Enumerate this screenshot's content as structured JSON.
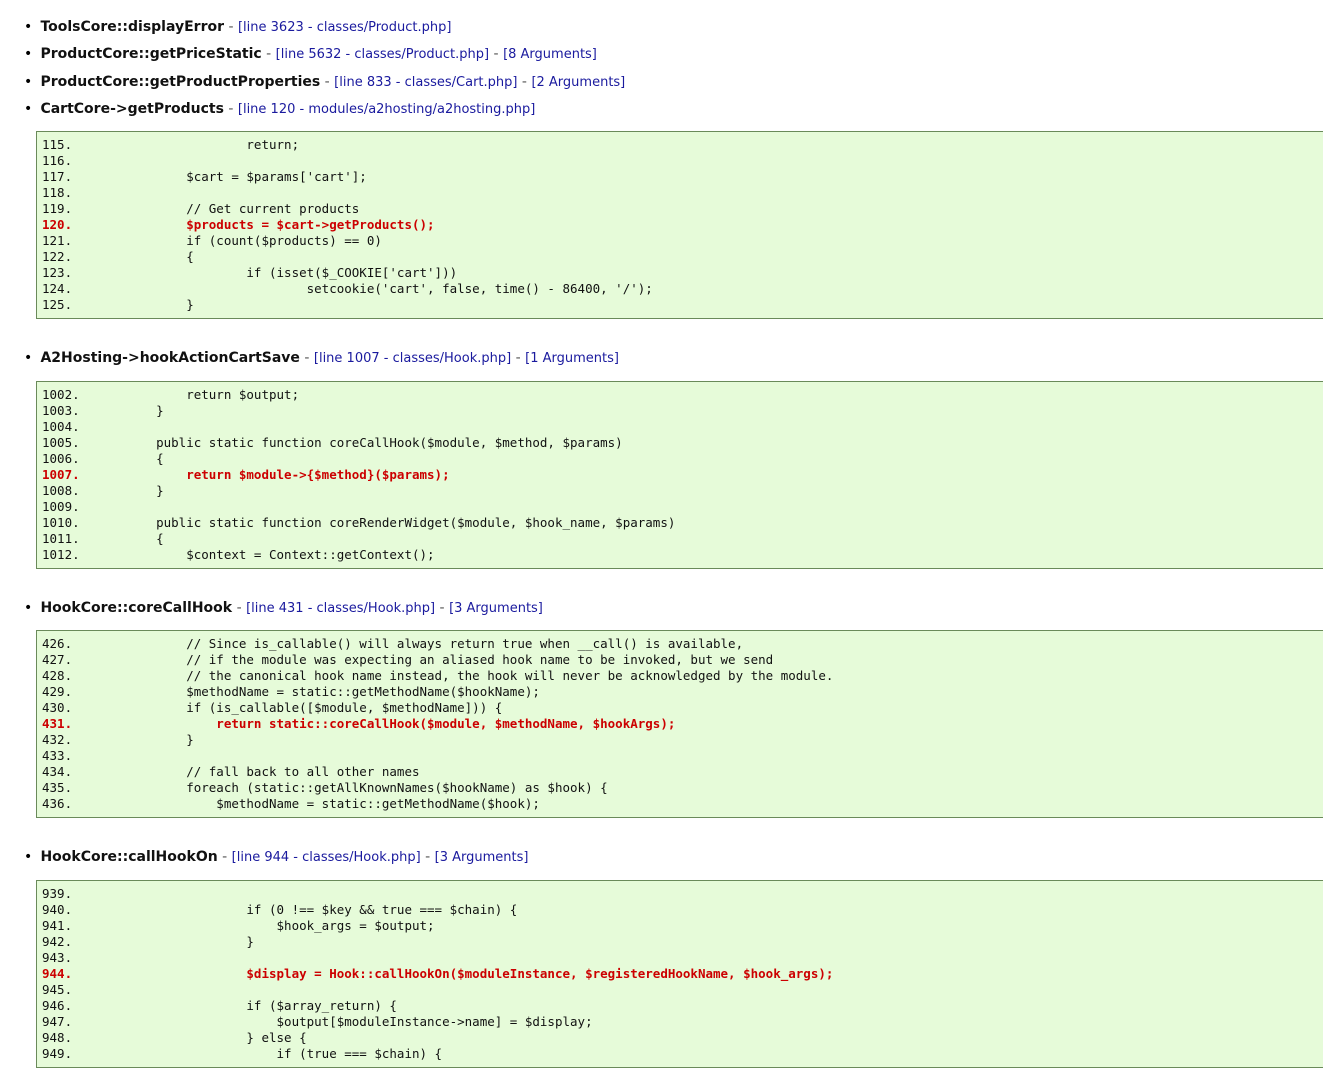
{
  "trace_items": [
    {
      "func": "ToolsCore::displayError",
      "location": "[line 3623 - classes/Product.php]",
      "args": ""
    },
    {
      "func": "ProductCore::getPriceStatic",
      "location": "[line 5632 - classes/Product.php]",
      "args": "[8 Arguments]"
    },
    {
      "func": "ProductCore::getProductProperties",
      "location": "[line 833 - classes/Cart.php]",
      "args": "[2 Arguments]"
    },
    {
      "func": "CartCore->getProducts",
      "location": "[line 120 - modules/a2hosting/a2hosting.php]",
      "args": ""
    },
    {
      "func": "A2Hosting->hookActionCartSave",
      "location": "[line 1007 - classes/Hook.php]",
      "args": "[1 Arguments]"
    },
    {
      "func": "HookCore::coreCallHook",
      "location": "[line 431 - classes/Hook.php]",
      "args": "[3 Arguments]"
    },
    {
      "func": "HookCore::callHookOn",
      "location": "[line 944 - classes/Hook.php]",
      "args": "[3 Arguments]"
    }
  ],
  "separator": "-",
  "code_blocks": [
    {
      "lines": [
        {
          "num": "115.",
          "code": "                return;",
          "hl": false
        },
        {
          "num": "116.",
          "code": "",
          "hl": false
        },
        {
          "num": "117.",
          "code": "        $cart = $params['cart'];",
          "hl": false
        },
        {
          "num": "118.",
          "code": "",
          "hl": false
        },
        {
          "num": "119.",
          "code": "        // Get current products",
          "hl": false
        },
        {
          "num": "120.",
          "code": "        $products = $cart->getProducts();",
          "hl": true
        },
        {
          "num": "121.",
          "code": "        if (count($products) == 0)",
          "hl": false
        },
        {
          "num": "122.",
          "code": "        {",
          "hl": false
        },
        {
          "num": "123.",
          "code": "                if (isset($_COOKIE['cart']))",
          "hl": false
        },
        {
          "num": "124.",
          "code": "                        setcookie('cart', false, time() - 86400, '/');",
          "hl": false
        },
        {
          "num": "125.",
          "code": "        }",
          "hl": false
        }
      ]
    },
    {
      "lines": [
        {
          "num": "1002.",
          "code": "        return $output;",
          "hl": false
        },
        {
          "num": "1003.",
          "code": "    }",
          "hl": false
        },
        {
          "num": "1004.",
          "code": "",
          "hl": false
        },
        {
          "num": "1005.",
          "code": "    public static function coreCallHook($module, $method, $params)",
          "hl": false
        },
        {
          "num": "1006.",
          "code": "    {",
          "hl": false
        },
        {
          "num": "1007.",
          "code": "        return $module->{$method}($params);",
          "hl": true
        },
        {
          "num": "1008.",
          "code": "    }",
          "hl": false
        },
        {
          "num": "1009.",
          "code": "",
          "hl": false
        },
        {
          "num": "1010.",
          "code": "    public static function coreRenderWidget($module, $hook_name, $params)",
          "hl": false
        },
        {
          "num": "1011.",
          "code": "    {",
          "hl": false
        },
        {
          "num": "1012.",
          "code": "        $context = Context::getContext();",
          "hl": false
        }
      ]
    },
    {
      "lines": [
        {
          "num": "426.",
          "code": "        // Since is_callable() will always return true when __call() is available,",
          "hl": false
        },
        {
          "num": "427.",
          "code": "        // if the module was expecting an aliased hook name to be invoked, but we send",
          "hl": false
        },
        {
          "num": "428.",
          "code": "        // the canonical hook name instead, the hook will never be acknowledged by the module.",
          "hl": false
        },
        {
          "num": "429.",
          "code": "        $methodName = static::getMethodName($hookName);",
          "hl": false
        },
        {
          "num": "430.",
          "code": "        if (is_callable([$module, $methodName])) {",
          "hl": false
        },
        {
          "num": "431.",
          "code": "            return static::coreCallHook($module, $methodName, $hookArgs);",
          "hl": true
        },
        {
          "num": "432.",
          "code": "        }",
          "hl": false
        },
        {
          "num": "433.",
          "code": "",
          "hl": false
        },
        {
          "num": "434.",
          "code": "        // fall back to all other names",
          "hl": false
        },
        {
          "num": "435.",
          "code": "        foreach (static::getAllKnownNames($hookName) as $hook) {",
          "hl": false
        },
        {
          "num": "436.",
          "code": "            $methodName = static::getMethodName($hook);",
          "hl": false
        }
      ]
    },
    {
      "lines": [
        {
          "num": "939.",
          "code": "",
          "hl": false
        },
        {
          "num": "940.",
          "code": "                if (0 !== $key && true === $chain) {",
          "hl": false
        },
        {
          "num": "941.",
          "code": "                    $hook_args = $output;",
          "hl": false
        },
        {
          "num": "942.",
          "code": "                }",
          "hl": false
        },
        {
          "num": "943.",
          "code": "",
          "hl": false
        },
        {
          "num": "944.",
          "code": "                $display = Hook::callHookOn($moduleInstance, $registeredHookName, $hook_args);",
          "hl": true
        },
        {
          "num": "945.",
          "code": "",
          "hl": false
        },
        {
          "num": "946.",
          "code": "                if ($array_return) {",
          "hl": false
        },
        {
          "num": "947.",
          "code": "                    $output[$moduleInstance->name] = $display;",
          "hl": false
        },
        {
          "num": "948.",
          "code": "                } else {",
          "hl": false
        },
        {
          "num": "949.",
          "code": "                    if (true === $chain) {",
          "hl": false
        }
      ]
    }
  ]
}
